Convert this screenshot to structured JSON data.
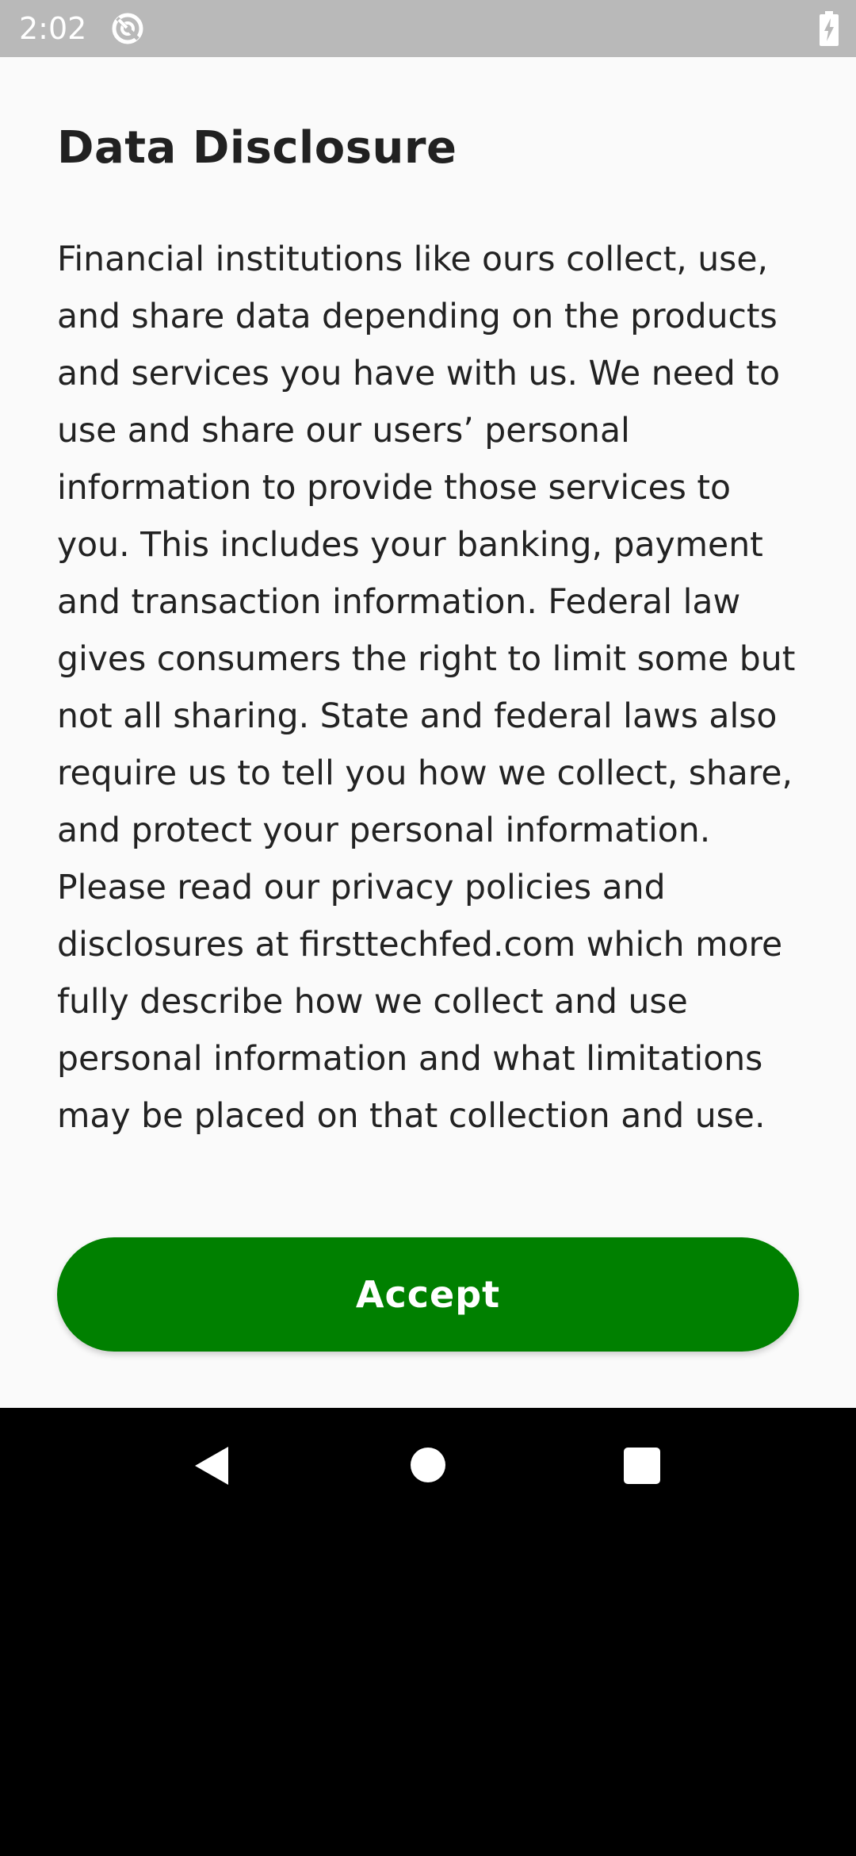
{
  "status_bar": {
    "time": "2:02",
    "icons": [
      "sync-icon",
      "battery-charging-icon"
    ]
  },
  "dialog": {
    "title": "Data Disclosure",
    "body": "Financial institutions like ours collect, use, and share data depending on the products and services you have with us. We need to use and share our users’ personal information to provide those services to you. This includes your banking, payment and transaction information. Federal law gives consumers the right to limit some but not all sharing. State and federal laws also require us to tell you how we collect, share, and protect your personal information. Please read our privacy policies and disclosures at firsttechfed.com which more fully describe how we collect and use personal information and what limitations may be placed on that collection and use.",
    "accept_label": "Accept"
  },
  "nav_bar": {
    "icons": [
      "back-icon",
      "home-icon",
      "recents-icon"
    ]
  },
  "colors": {
    "accent": "#008000",
    "background": "#fafafa",
    "status_bar": "#b9b9b9",
    "nav_bar": "#000000"
  }
}
